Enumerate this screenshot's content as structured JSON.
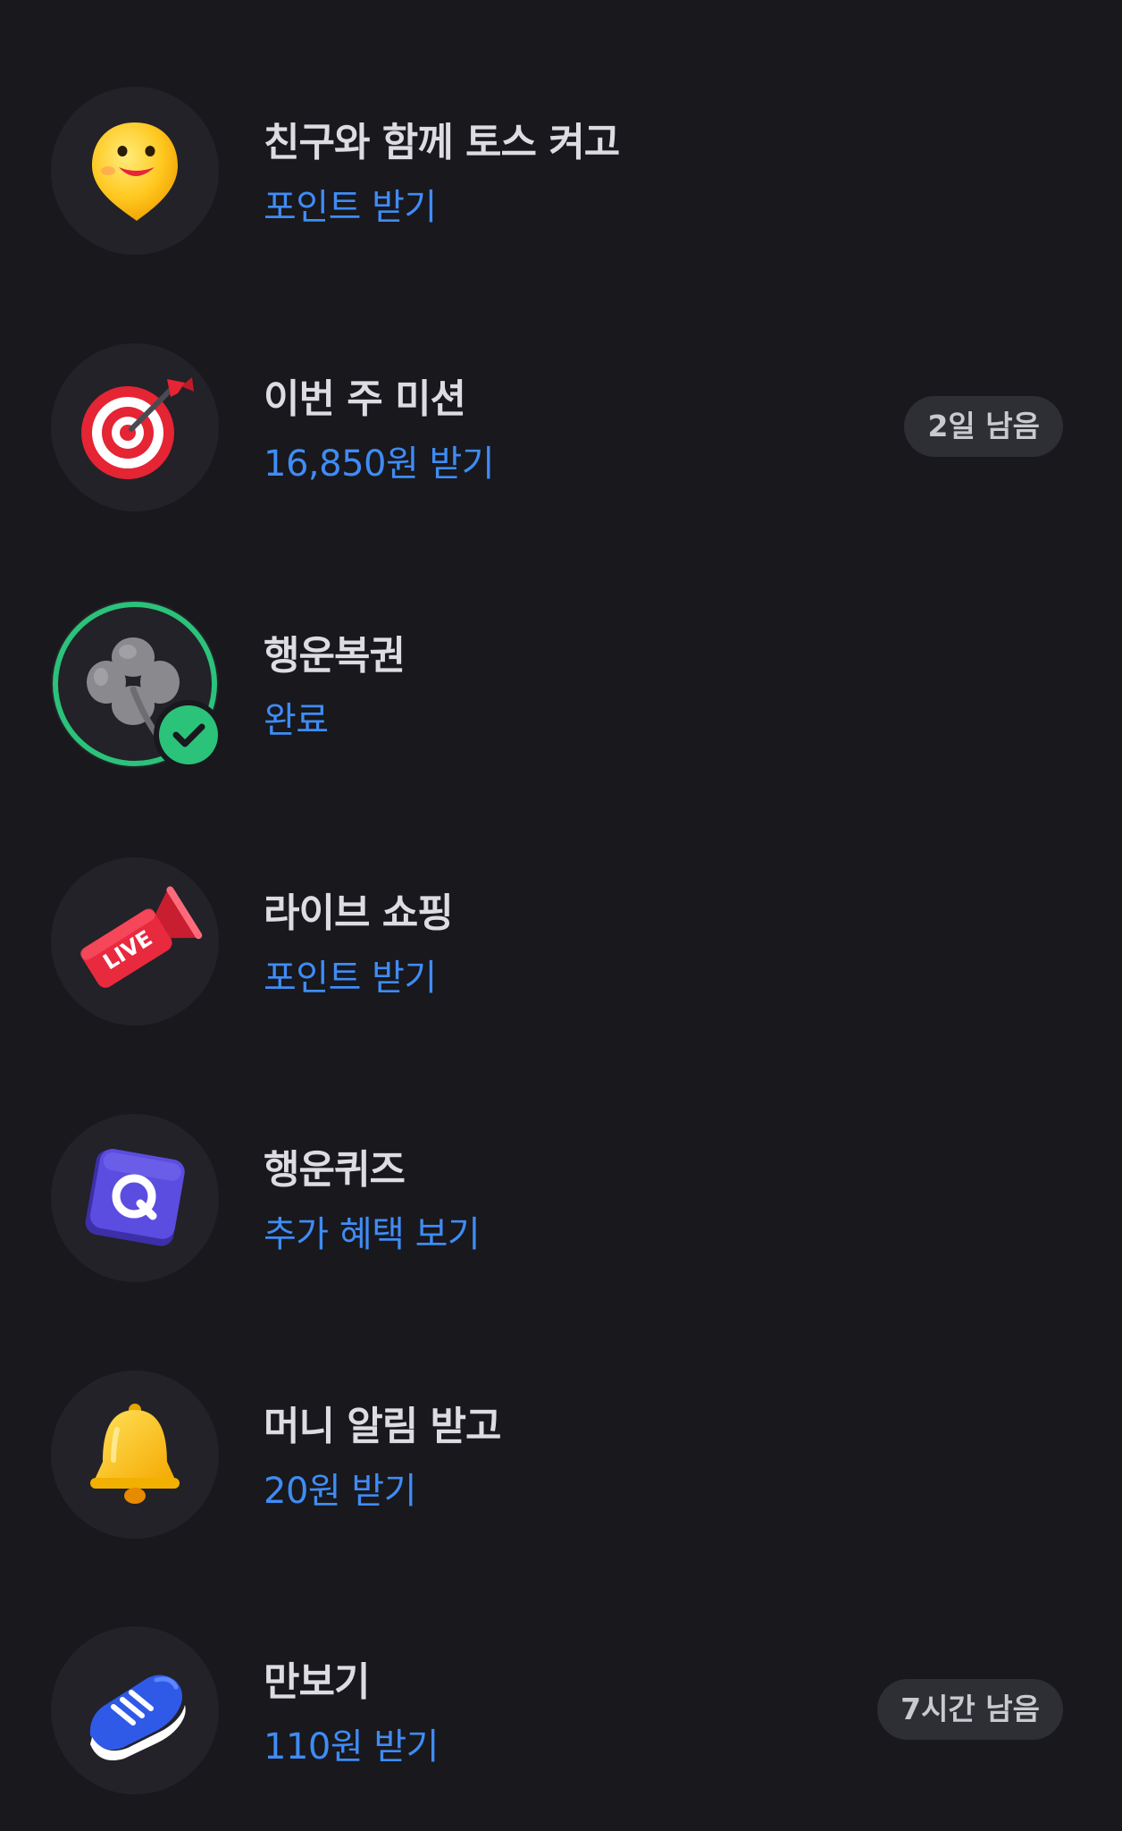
{
  "items": [
    {
      "title": "친구와 함께 토스 켜고",
      "subtitle": "포인트 받기",
      "icon": "smiley-pin-icon"
    },
    {
      "title": "이번 주 미션",
      "subtitle": "16,850원 받기",
      "badge": "2일 남음",
      "icon": "dart-target-icon"
    },
    {
      "title": "행운복권",
      "subtitle": "완료",
      "icon": "clover-icon",
      "status": "completed",
      "accent": "#2bc27a"
    },
    {
      "title": "라이브 쇼핑",
      "subtitle": "포인트 받기",
      "icon": "live-megaphone-icon"
    },
    {
      "title": "행운퀴즈",
      "subtitle": "추가 혜택 보기",
      "icon": "quiz-block-icon"
    },
    {
      "title": "머니 알림 받고",
      "subtitle": "20원 받기",
      "icon": "bell-icon"
    },
    {
      "title": "만보기",
      "subtitle": "110원 받기",
      "badge": "7시간 남음",
      "icon": "sneaker-icon"
    }
  ],
  "colors": {
    "background": "#18181d",
    "icon_bg": "#222228",
    "title": "#dcdce2",
    "subtitle": "#3f8cf5",
    "badge_bg": "#2e2e35",
    "complete_green": "#2bc27a"
  }
}
